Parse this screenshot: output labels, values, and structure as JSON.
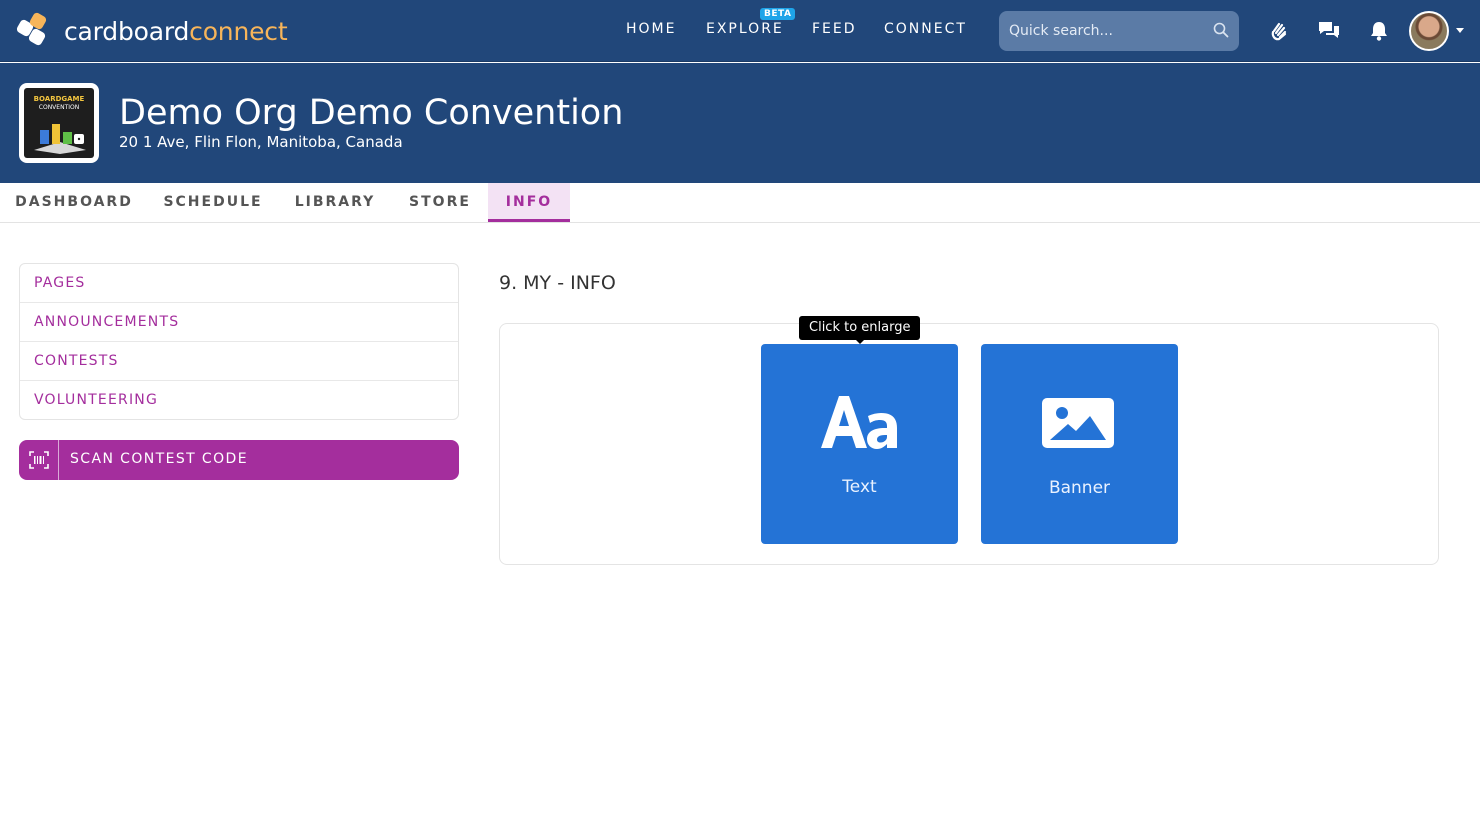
{
  "app": {
    "logo_text_main": "cardboard",
    "logo_text_accent": "connect"
  },
  "topnav": {
    "items": [
      {
        "label": "HOME"
      },
      {
        "label": "EXPLORE"
      },
      {
        "label": "FEED"
      },
      {
        "label": "CONNECT"
      }
    ],
    "beta_badge": "BETA",
    "search_placeholder": "Quick search..."
  },
  "event": {
    "title": "Demo Org Demo Convention",
    "address": "20 1 Ave, Flin Flon, Manitoba, Canada",
    "logo_line1": "BOARDGAME",
    "logo_line2": "CONVENTION"
  },
  "tabs": [
    {
      "label": "DASHBOARD"
    },
    {
      "label": "SCHEDULE"
    },
    {
      "label": "LIBRARY"
    },
    {
      "label": "STORE"
    },
    {
      "label": "INFO"
    }
  ],
  "sidebar": {
    "items": [
      {
        "label": "PAGES"
      },
      {
        "label": "ANNOUNCEMENTS"
      },
      {
        "label": "CONTESTS"
      },
      {
        "label": "VOLUNTEERING"
      }
    ],
    "scan_button": "SCAN CONTEST CODE"
  },
  "main": {
    "section_title": "9. MY - INFO",
    "tooltip": "Click to enlarge",
    "tiles": [
      {
        "label": "Text",
        "icon": "text-format-icon"
      },
      {
        "label": "Banner",
        "icon": "image-icon"
      }
    ]
  },
  "colors": {
    "nav_bg": "#21477a",
    "accent_purple": "#a42e9d",
    "tile_blue": "#2473d6",
    "logo_accent": "#f7b55a"
  }
}
